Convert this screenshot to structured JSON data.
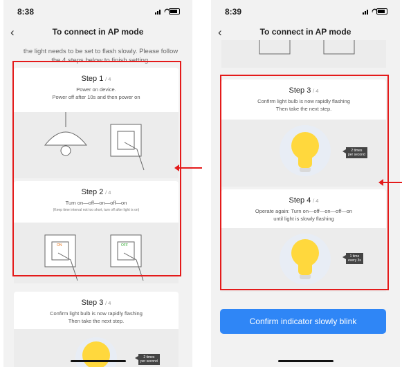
{
  "left_screen": {
    "status_time": "8:38",
    "title": "To connect in AP mode",
    "intro": "the light needs to be set to flash slowly. Please follow the 4 steps below to finish setting.",
    "step1": {
      "label": "Step 1",
      "of": "/ 4",
      "desc1": "Power on device.",
      "desc2": "Power off after 10s and then power on"
    },
    "step2": {
      "label": "Step 2",
      "of": "/ 4",
      "desc1": "Turn on—off—on—off—on",
      "note": "(Keep time interval not too short, turn off after light is on)",
      "on_label": "ON",
      "off_label": "OFF"
    },
    "step3": {
      "label": "Step 3",
      "of": "/ 4",
      "desc1": "Confirm light bulb is now rapidly flashing",
      "desc2": "Then take the next step.",
      "tag1": "2 times",
      "tag2": "per second"
    }
  },
  "right_screen": {
    "status_time": "8:39",
    "title": "To connect in AP mode",
    "step3": {
      "label": "Step 3",
      "of": "/ 4",
      "desc1": "Confirm light bulb is now rapidly flashing",
      "desc2": "Then take the next step.",
      "tag1": "2 times",
      "tag2": "per second"
    },
    "step4": {
      "label": "Step 4",
      "of": "/ 4",
      "desc1": "Operate again: Turn on—off—on—off—on",
      "desc2": "until light is slowly flashing",
      "tag1": "1 time",
      "tag2": "every 3s"
    },
    "confirm_button": "Confirm indicator slowly blink"
  },
  "icons": {
    "back": "chevron-left-icon",
    "arrow": "red-arrow-icon",
    "bulb": "light-bulb-icon",
    "switch": "wall-switch-icon",
    "lamp": "ceiling-lamp-icon"
  },
  "colors": {
    "highlight": "#e41a1a",
    "button": "#2f86f6",
    "bulb": "#ffd83d"
  }
}
